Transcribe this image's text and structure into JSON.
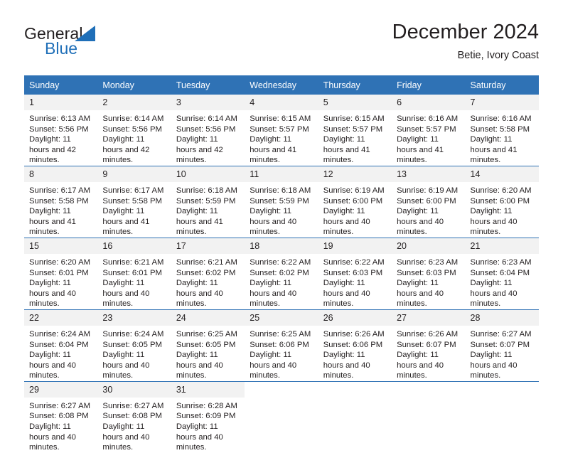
{
  "brand": {
    "name_part1": "General",
    "name_part2": "Blue",
    "logo_icon": "triangle-icon",
    "accent_color": "#1f6fb8"
  },
  "header": {
    "title": "December 2024",
    "subtitle": "Betie, Ivory Coast"
  },
  "calendar": {
    "header_bg": "#2f72b5",
    "daynum_bg": "#f2f2f2",
    "weekdays": [
      "Sunday",
      "Monday",
      "Tuesday",
      "Wednesday",
      "Thursday",
      "Friday",
      "Saturday"
    ],
    "weeks": [
      [
        {
          "day": "1",
          "sunrise": "Sunrise: 6:13 AM",
          "sunset": "Sunset: 5:56 PM",
          "daylight": "Daylight: 11 hours and 42 minutes."
        },
        {
          "day": "2",
          "sunrise": "Sunrise: 6:14 AM",
          "sunset": "Sunset: 5:56 PM",
          "daylight": "Daylight: 11 hours and 42 minutes."
        },
        {
          "day": "3",
          "sunrise": "Sunrise: 6:14 AM",
          "sunset": "Sunset: 5:56 PM",
          "daylight": "Daylight: 11 hours and 42 minutes."
        },
        {
          "day": "4",
          "sunrise": "Sunrise: 6:15 AM",
          "sunset": "Sunset: 5:57 PM",
          "daylight": "Daylight: 11 hours and 41 minutes."
        },
        {
          "day": "5",
          "sunrise": "Sunrise: 6:15 AM",
          "sunset": "Sunset: 5:57 PM",
          "daylight": "Daylight: 11 hours and 41 minutes."
        },
        {
          "day": "6",
          "sunrise": "Sunrise: 6:16 AM",
          "sunset": "Sunset: 5:57 PM",
          "daylight": "Daylight: 11 hours and 41 minutes."
        },
        {
          "day": "7",
          "sunrise": "Sunrise: 6:16 AM",
          "sunset": "Sunset: 5:58 PM",
          "daylight": "Daylight: 11 hours and 41 minutes."
        }
      ],
      [
        {
          "day": "8",
          "sunrise": "Sunrise: 6:17 AM",
          "sunset": "Sunset: 5:58 PM",
          "daylight": "Daylight: 11 hours and 41 minutes."
        },
        {
          "day": "9",
          "sunrise": "Sunrise: 6:17 AM",
          "sunset": "Sunset: 5:58 PM",
          "daylight": "Daylight: 11 hours and 41 minutes."
        },
        {
          "day": "10",
          "sunrise": "Sunrise: 6:18 AM",
          "sunset": "Sunset: 5:59 PM",
          "daylight": "Daylight: 11 hours and 41 minutes."
        },
        {
          "day": "11",
          "sunrise": "Sunrise: 6:18 AM",
          "sunset": "Sunset: 5:59 PM",
          "daylight": "Daylight: 11 hours and 40 minutes."
        },
        {
          "day": "12",
          "sunrise": "Sunrise: 6:19 AM",
          "sunset": "Sunset: 6:00 PM",
          "daylight": "Daylight: 11 hours and 40 minutes."
        },
        {
          "day": "13",
          "sunrise": "Sunrise: 6:19 AM",
          "sunset": "Sunset: 6:00 PM",
          "daylight": "Daylight: 11 hours and 40 minutes."
        },
        {
          "day": "14",
          "sunrise": "Sunrise: 6:20 AM",
          "sunset": "Sunset: 6:00 PM",
          "daylight": "Daylight: 11 hours and 40 minutes."
        }
      ],
      [
        {
          "day": "15",
          "sunrise": "Sunrise: 6:20 AM",
          "sunset": "Sunset: 6:01 PM",
          "daylight": "Daylight: 11 hours and 40 minutes."
        },
        {
          "day": "16",
          "sunrise": "Sunrise: 6:21 AM",
          "sunset": "Sunset: 6:01 PM",
          "daylight": "Daylight: 11 hours and 40 minutes."
        },
        {
          "day": "17",
          "sunrise": "Sunrise: 6:21 AM",
          "sunset": "Sunset: 6:02 PM",
          "daylight": "Daylight: 11 hours and 40 minutes."
        },
        {
          "day": "18",
          "sunrise": "Sunrise: 6:22 AM",
          "sunset": "Sunset: 6:02 PM",
          "daylight": "Daylight: 11 hours and 40 minutes."
        },
        {
          "day": "19",
          "sunrise": "Sunrise: 6:22 AM",
          "sunset": "Sunset: 6:03 PM",
          "daylight": "Daylight: 11 hours and 40 minutes."
        },
        {
          "day": "20",
          "sunrise": "Sunrise: 6:23 AM",
          "sunset": "Sunset: 6:03 PM",
          "daylight": "Daylight: 11 hours and 40 minutes."
        },
        {
          "day": "21",
          "sunrise": "Sunrise: 6:23 AM",
          "sunset": "Sunset: 6:04 PM",
          "daylight": "Daylight: 11 hours and 40 minutes."
        }
      ],
      [
        {
          "day": "22",
          "sunrise": "Sunrise: 6:24 AM",
          "sunset": "Sunset: 6:04 PM",
          "daylight": "Daylight: 11 hours and 40 minutes."
        },
        {
          "day": "23",
          "sunrise": "Sunrise: 6:24 AM",
          "sunset": "Sunset: 6:05 PM",
          "daylight": "Daylight: 11 hours and 40 minutes."
        },
        {
          "day": "24",
          "sunrise": "Sunrise: 6:25 AM",
          "sunset": "Sunset: 6:05 PM",
          "daylight": "Daylight: 11 hours and 40 minutes."
        },
        {
          "day": "25",
          "sunrise": "Sunrise: 6:25 AM",
          "sunset": "Sunset: 6:06 PM",
          "daylight": "Daylight: 11 hours and 40 minutes."
        },
        {
          "day": "26",
          "sunrise": "Sunrise: 6:26 AM",
          "sunset": "Sunset: 6:06 PM",
          "daylight": "Daylight: 11 hours and 40 minutes."
        },
        {
          "day": "27",
          "sunrise": "Sunrise: 6:26 AM",
          "sunset": "Sunset: 6:07 PM",
          "daylight": "Daylight: 11 hours and 40 minutes."
        },
        {
          "day": "28",
          "sunrise": "Sunrise: 6:27 AM",
          "sunset": "Sunset: 6:07 PM",
          "daylight": "Daylight: 11 hours and 40 minutes."
        }
      ],
      [
        {
          "day": "29",
          "sunrise": "Sunrise: 6:27 AM",
          "sunset": "Sunset: 6:08 PM",
          "daylight": "Daylight: 11 hours and 40 minutes."
        },
        {
          "day": "30",
          "sunrise": "Sunrise: 6:27 AM",
          "sunset": "Sunset: 6:08 PM",
          "daylight": "Daylight: 11 hours and 40 minutes."
        },
        {
          "day": "31",
          "sunrise": "Sunrise: 6:28 AM",
          "sunset": "Sunset: 6:09 PM",
          "daylight": "Daylight: 11 hours and 40 minutes."
        },
        {
          "day": "",
          "sunrise": "",
          "sunset": "",
          "daylight": ""
        },
        {
          "day": "",
          "sunrise": "",
          "sunset": "",
          "daylight": ""
        },
        {
          "day": "",
          "sunrise": "",
          "sunset": "",
          "daylight": ""
        },
        {
          "day": "",
          "sunrise": "",
          "sunset": "",
          "daylight": ""
        }
      ]
    ]
  }
}
